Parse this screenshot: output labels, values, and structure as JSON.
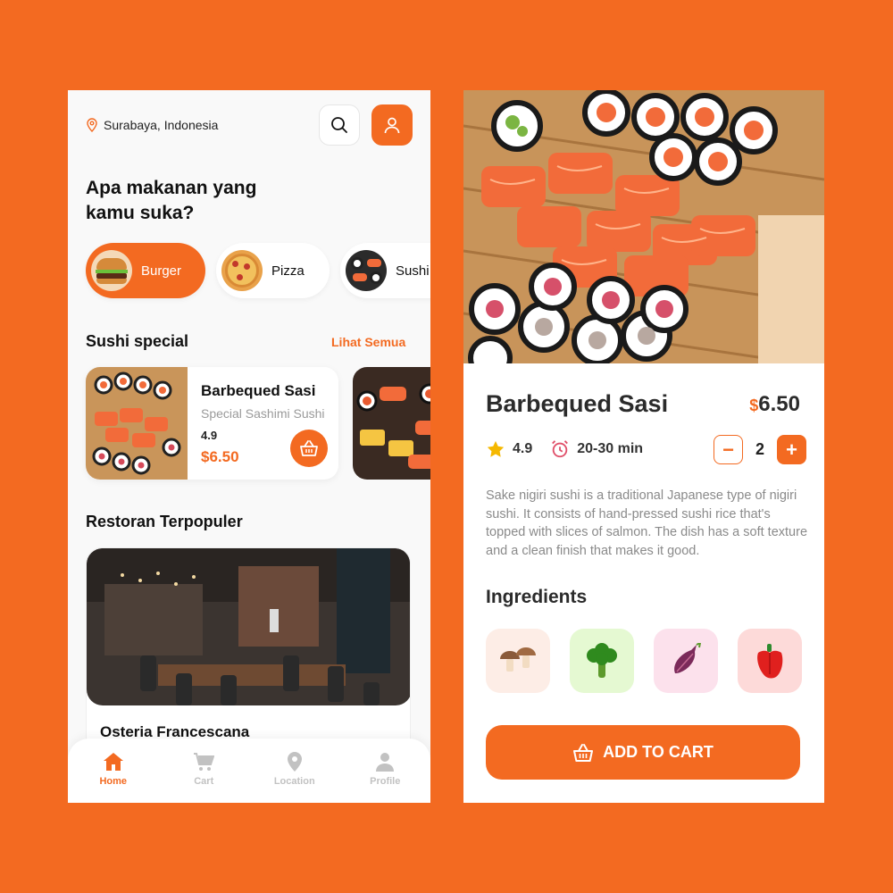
{
  "home": {
    "location": "Surabaya, Indonesia",
    "headline_line1": "Apa makanan yang",
    "headline_line2": "kamu suka?",
    "categories": [
      {
        "label": "Burger",
        "active": true
      },
      {
        "label": "Pizza",
        "active": false
      },
      {
        "label": "Sushi",
        "active": false
      }
    ],
    "special_section": {
      "title": "Sushi special",
      "see_all": "Lihat Semua"
    },
    "food_card": {
      "title": "Barbequed Sasi",
      "subtitle": "Special Sashimi Sushi",
      "rating": "4.9",
      "price": "$6.50"
    },
    "popular_section": {
      "title": "Restoran Terpopuler"
    },
    "restaurant": {
      "name": "Osteria Francescana"
    },
    "nav": [
      {
        "label": "Home",
        "icon": "home-icon",
        "active": true
      },
      {
        "label": "Cart",
        "icon": "cart-icon",
        "active": false
      },
      {
        "label": "Location",
        "icon": "location-pin-icon",
        "active": false
      },
      {
        "label": "Profile",
        "icon": "user-icon",
        "active": false
      }
    ]
  },
  "detail": {
    "title": "Barbequed Sasi",
    "currency": "$",
    "price": "6.50",
    "rating": "4.9",
    "time": "20-30 min",
    "quantity": "2",
    "minus": "−",
    "plus": "+",
    "description": "Sake nigiri sushi is a traditional Japanese type of nigiri sushi. It consists of hand-pressed sushi rice that's topped with slices of salmon. The dish has a soft texture and a clean finish that makes it good.",
    "ingredients_title": "Ingredients",
    "ingredients": [
      {
        "icon": "mushroom-icon",
        "bg": "#FDEDE6"
      },
      {
        "icon": "broccoli-icon",
        "bg": "#E5F9D2"
      },
      {
        "icon": "onion-icon",
        "bg": "#FCE1EC"
      },
      {
        "icon": "bell-pepper-icon",
        "bg": "#FDDAD9"
      }
    ],
    "add_to_cart": "ADD TO CART"
  },
  "colors": {
    "accent": "#F36A21",
    "background": "#F36A21"
  }
}
